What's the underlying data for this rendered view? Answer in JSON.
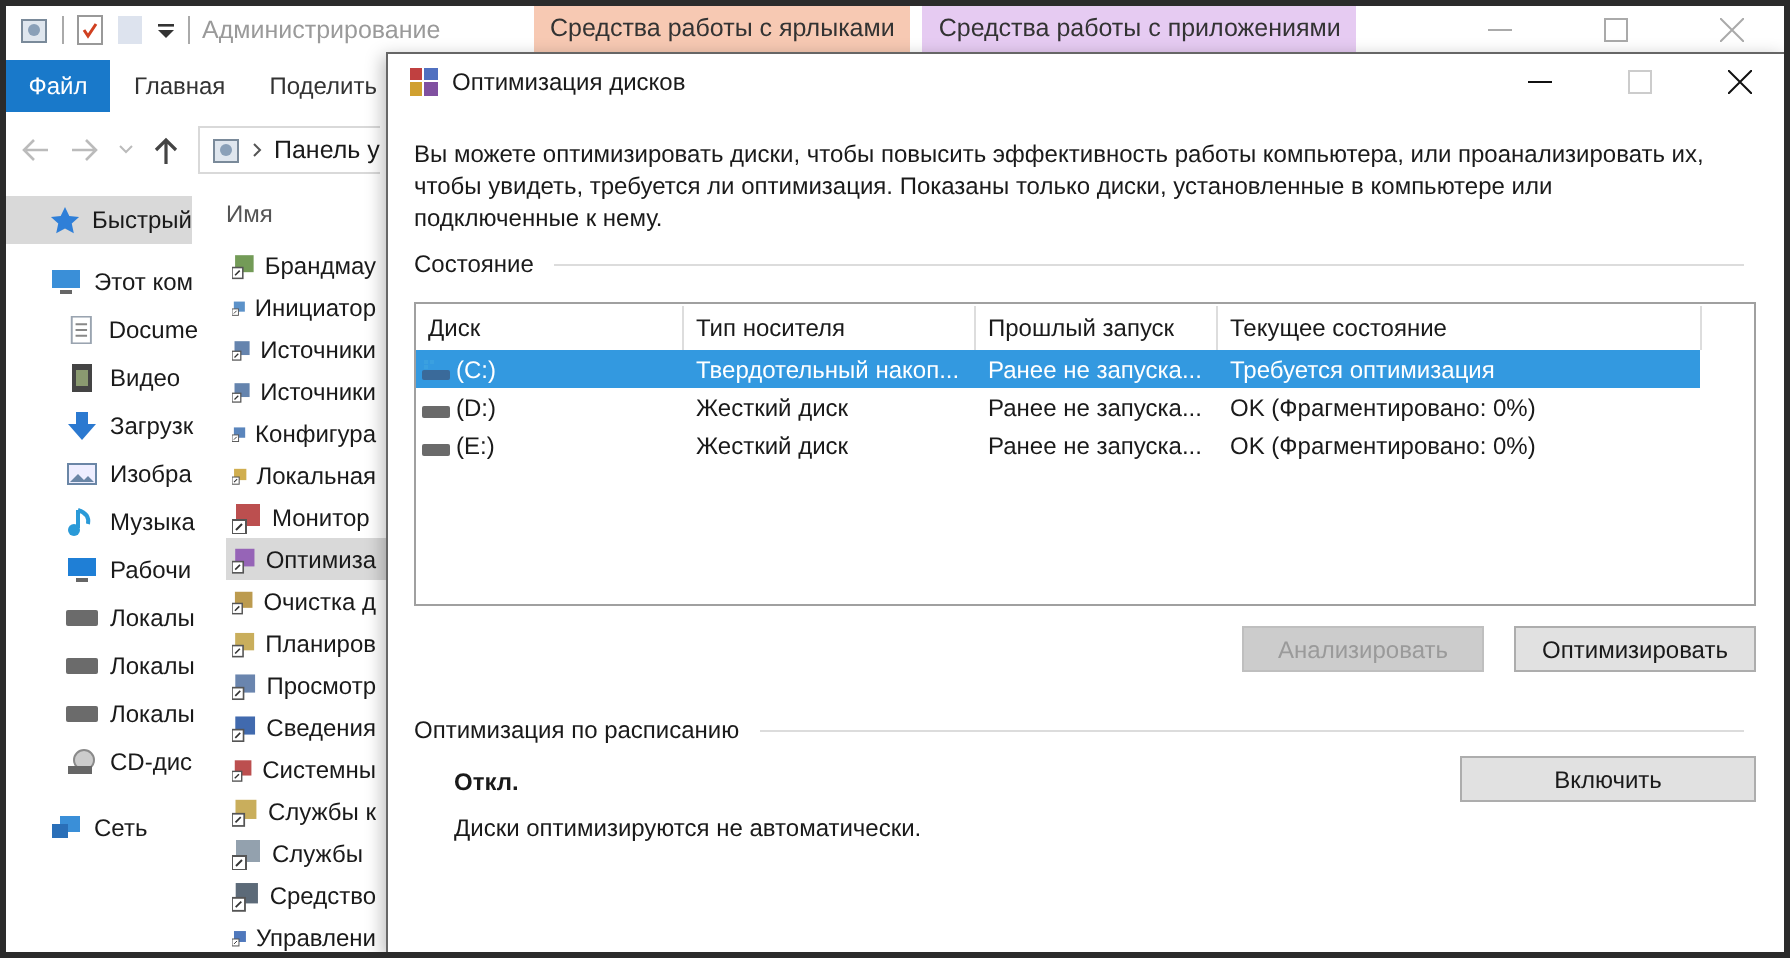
{
  "explorer": {
    "title": "Администрирование",
    "context_tabs": [
      {
        "label": "Средства работы с ярлыками",
        "color": "#f7c9b3"
      },
      {
        "label": "Средства работы с приложениями",
        "color": "#e6cbf2"
      }
    ],
    "ribbon_tabs": [
      {
        "label": "Файл",
        "selected": true
      },
      {
        "label": "Главная",
        "selected": false
      },
      {
        "label": "Поделить",
        "selected": false
      }
    ],
    "address": "Панель у",
    "nav": [
      {
        "label": "Быстрый",
        "kind": "star",
        "selected": true
      },
      {
        "label": "Этот ком",
        "kind": "pc",
        "selected": false,
        "children": [
          {
            "label": "Docume",
            "kind": "doc",
            "selected": false
          },
          {
            "label": "Видео",
            "kind": "video",
            "selected": false
          },
          {
            "label": "Загрузк",
            "kind": "download",
            "selected": false
          },
          {
            "label": "Изобра",
            "kind": "image",
            "selected": false
          },
          {
            "label": "Музыка",
            "kind": "music",
            "selected": false
          },
          {
            "label": "Рабочи",
            "kind": "desktop",
            "selected": false
          },
          {
            "label": "Локалы",
            "kind": "drive",
            "selected": false
          },
          {
            "label": "Локалы",
            "kind": "drive",
            "selected": false
          },
          {
            "label": "Локалы",
            "kind": "drive",
            "selected": false
          },
          {
            "label": "CD-дис",
            "kind": "cd",
            "selected": false
          }
        ]
      },
      {
        "label": "Сеть",
        "kind": "network",
        "selected": false
      }
    ],
    "column_header": "Имя",
    "items": [
      {
        "label": "Брандмау",
        "selected": false
      },
      {
        "label": "Инициатор",
        "selected": false
      },
      {
        "label": "Источники",
        "selected": false
      },
      {
        "label": "Источники",
        "selected": false
      },
      {
        "label": "Конфигура",
        "selected": false
      },
      {
        "label": "Локальная",
        "selected": false
      },
      {
        "label": "Монитор",
        "selected": false
      },
      {
        "label": "Оптимиза",
        "selected": true
      },
      {
        "label": "Очистка д",
        "selected": false
      },
      {
        "label": "Планиров",
        "selected": false
      },
      {
        "label": "Просмотр",
        "selected": false
      },
      {
        "label": "Сведения",
        "selected": false
      },
      {
        "label": "Системны",
        "selected": false
      },
      {
        "label": "Службы к",
        "selected": false
      },
      {
        "label": "Службы",
        "selected": false
      },
      {
        "label": "Средство",
        "selected": false
      },
      {
        "label": "Управлени",
        "selected": false
      }
    ]
  },
  "dialog": {
    "title": "Оптимизация дисков",
    "description": "Вы можете оптимизировать диски, чтобы повысить эффективность работы  компьютера, или проанализировать их, чтобы увидеть, требуется ли оптимизация. Показаны только диски, установленные в компьютере или подключенные к нему.",
    "status_heading": "Состояние",
    "table": {
      "columns": [
        "Диск",
        "Тип носителя",
        "Прошлый запуск",
        "Текущее состояние"
      ],
      "rows": [
        {
          "kind": "ssd",
          "selected": true,
          "cells": [
            "(C:)",
            "Твердотельный накоп...",
            "Ранее не запуска...",
            "Требуется оптимизация"
          ]
        },
        {
          "kind": "hdd",
          "selected": false,
          "cells": [
            "(D:)",
            "Жесткий диск",
            "Ранее не запуска...",
            "OK (Фрагментировано: 0%)"
          ]
        },
        {
          "kind": "hdd",
          "selected": false,
          "cells": [
            "(E:)",
            "Жесткий диск",
            "Ранее не запуска...",
            "OK (Фрагментировано: 0%)"
          ]
        }
      ]
    },
    "buttons": [
      {
        "label": "Анализировать",
        "disabled": true
      },
      {
        "label": "Оптимизировать",
        "disabled": false
      }
    ],
    "schedule": {
      "heading": "Оптимизация по расписанию",
      "state": "Откл.",
      "note": "Диски оптимизируются не автоматически.",
      "button": "Включить"
    }
  }
}
